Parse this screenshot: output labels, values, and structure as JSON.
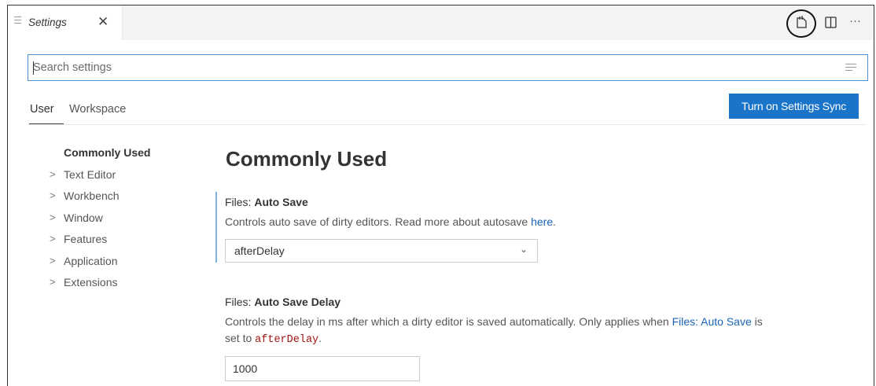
{
  "tab": {
    "title": "Settings",
    "close_glyph": "✕",
    "icon": "settings-file-icon"
  },
  "toolbar": {
    "icons": [
      "open-settings-json-icon",
      "split-editor-icon",
      "more-actions-icon"
    ],
    "more_glyph": "···"
  },
  "search": {
    "placeholder": "Search settings",
    "value": "",
    "filter_icon": "filter-list-icon"
  },
  "scopes": {
    "user": "User",
    "workspace": "Workspace",
    "active": "User"
  },
  "sync_button": {
    "label": "Turn on Settings Sync",
    "color": "#1a74c9"
  },
  "tree": {
    "items": [
      {
        "label": "Commonly Used",
        "chevron": ""
      },
      {
        "label": "Text Editor",
        "chevron": ">"
      },
      {
        "label": "Workbench",
        "chevron": ">"
      },
      {
        "label": "Window",
        "chevron": ">"
      },
      {
        "label": "Features",
        "chevron": ">"
      },
      {
        "label": "Application",
        "chevron": ">"
      },
      {
        "label": "Extensions",
        "chevron": ">"
      }
    ]
  },
  "content": {
    "heading": "Commonly Used",
    "auto_save": {
      "category": "Files: ",
      "name": "Auto Save",
      "desc_prefix": "Controls auto save of dirty editors. Read more about autosave ",
      "desc_link": "here",
      "desc_suffix": ".",
      "value": "afterDelay",
      "chevron": "⌄"
    },
    "auto_save_delay": {
      "category": "Files: ",
      "name": "Auto Save Delay",
      "desc_prefix": "Controls the delay in ms after which a dirty editor is saved automatically. Only applies when ",
      "desc_link": "Files: Auto Save",
      "desc_middle": " is",
      "desc_line2_prefix": "set to ",
      "desc_code": "afterDelay",
      "desc_suffix": ".",
      "value": "1000"
    }
  },
  "colors": {
    "accent": "#1a74c9",
    "link": "#1a64b4",
    "code": "#a31515",
    "focus": "#7fb2e0"
  }
}
